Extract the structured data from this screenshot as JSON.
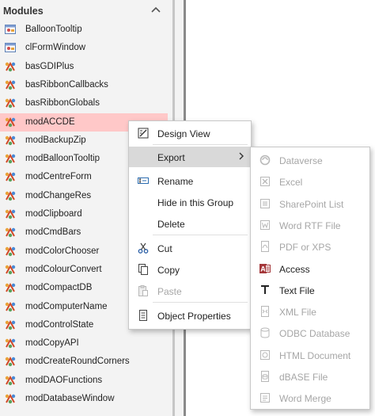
{
  "nav": {
    "title": "Modules",
    "items": [
      {
        "label": "BalloonTooltip",
        "icon": "class-module-icon"
      },
      {
        "label": "clFormWindow",
        "icon": "class-module-icon"
      },
      {
        "label": "basGDIPlus",
        "icon": "module-icon"
      },
      {
        "label": "basRibbonCallbacks",
        "icon": "module-icon"
      },
      {
        "label": "basRibbonGlobals",
        "icon": "module-icon"
      },
      {
        "label": "modACCDE",
        "icon": "module-icon",
        "selected": true
      },
      {
        "label": "modBackupZip",
        "icon": "module-icon"
      },
      {
        "label": "modBalloonTooltip",
        "icon": "module-icon"
      },
      {
        "label": "modCentreForm",
        "icon": "module-icon"
      },
      {
        "label": "modChangeRes",
        "icon": "module-icon"
      },
      {
        "label": "modClipboard",
        "icon": "module-icon"
      },
      {
        "label": "modCmdBars",
        "icon": "module-icon"
      },
      {
        "label": "modColorChooser",
        "icon": "module-icon"
      },
      {
        "label": "modColourConvert",
        "icon": "module-icon"
      },
      {
        "label": "modCompactDB",
        "icon": "module-icon"
      },
      {
        "label": "modComputerName",
        "icon": "module-icon"
      },
      {
        "label": "modControlState",
        "icon": "module-icon"
      },
      {
        "label": "modCopyAPI",
        "icon": "module-icon"
      },
      {
        "label": "modCreateRoundCorners",
        "icon": "module-icon"
      },
      {
        "label": "modDAOFunctions",
        "icon": "module-icon"
      },
      {
        "label": "modDatabaseWindow",
        "icon": "module-icon"
      }
    ]
  },
  "context_menu": {
    "items": [
      {
        "label": "Design View",
        "icon": "design-view-icon"
      },
      {
        "label": "Export",
        "icon": "",
        "submenu": true,
        "active": true
      },
      {
        "label": "Rename",
        "icon": "rename-icon"
      },
      {
        "label": "Hide in this Group",
        "icon": ""
      },
      {
        "label": "Delete",
        "icon": ""
      },
      {
        "label": "Cut",
        "icon": "scissors-icon"
      },
      {
        "label": "Copy",
        "icon": "copy-icon"
      },
      {
        "label": "Paste",
        "icon": "paste-icon",
        "disabled": true
      },
      {
        "label": "Object Properties",
        "icon": "properties-icon"
      }
    ]
  },
  "export_submenu": {
    "items": [
      {
        "label": "Dataverse",
        "icon": "dataverse-icon",
        "enabled": false
      },
      {
        "label": "Excel",
        "icon": "excel-icon",
        "enabled": false
      },
      {
        "label": "SharePoint List",
        "icon": "sharepoint-icon",
        "enabled": false
      },
      {
        "label": "Word RTF File",
        "icon": "word-icon",
        "enabled": false
      },
      {
        "label": "PDF or XPS",
        "icon": "pdf-icon",
        "enabled": false
      },
      {
        "label": "Access",
        "icon": "access-icon",
        "enabled": true
      },
      {
        "label": "Text File",
        "icon": "text-file-icon",
        "enabled": true
      },
      {
        "label": "XML File",
        "icon": "xml-icon",
        "enabled": false
      },
      {
        "label": "ODBC Database",
        "icon": "odbc-icon",
        "enabled": false
      },
      {
        "label": "HTML Document",
        "icon": "html-icon",
        "enabled": false
      },
      {
        "label": "dBASE File",
        "icon": "dbase-icon",
        "enabled": false
      },
      {
        "label": "Word Merge",
        "icon": "word-merge-icon",
        "enabled": false
      }
    ]
  },
  "colors": {
    "selected_bg": "#ffc8c8",
    "access_red": "#a4373a",
    "disabled_text": "#a6a6a6"
  }
}
